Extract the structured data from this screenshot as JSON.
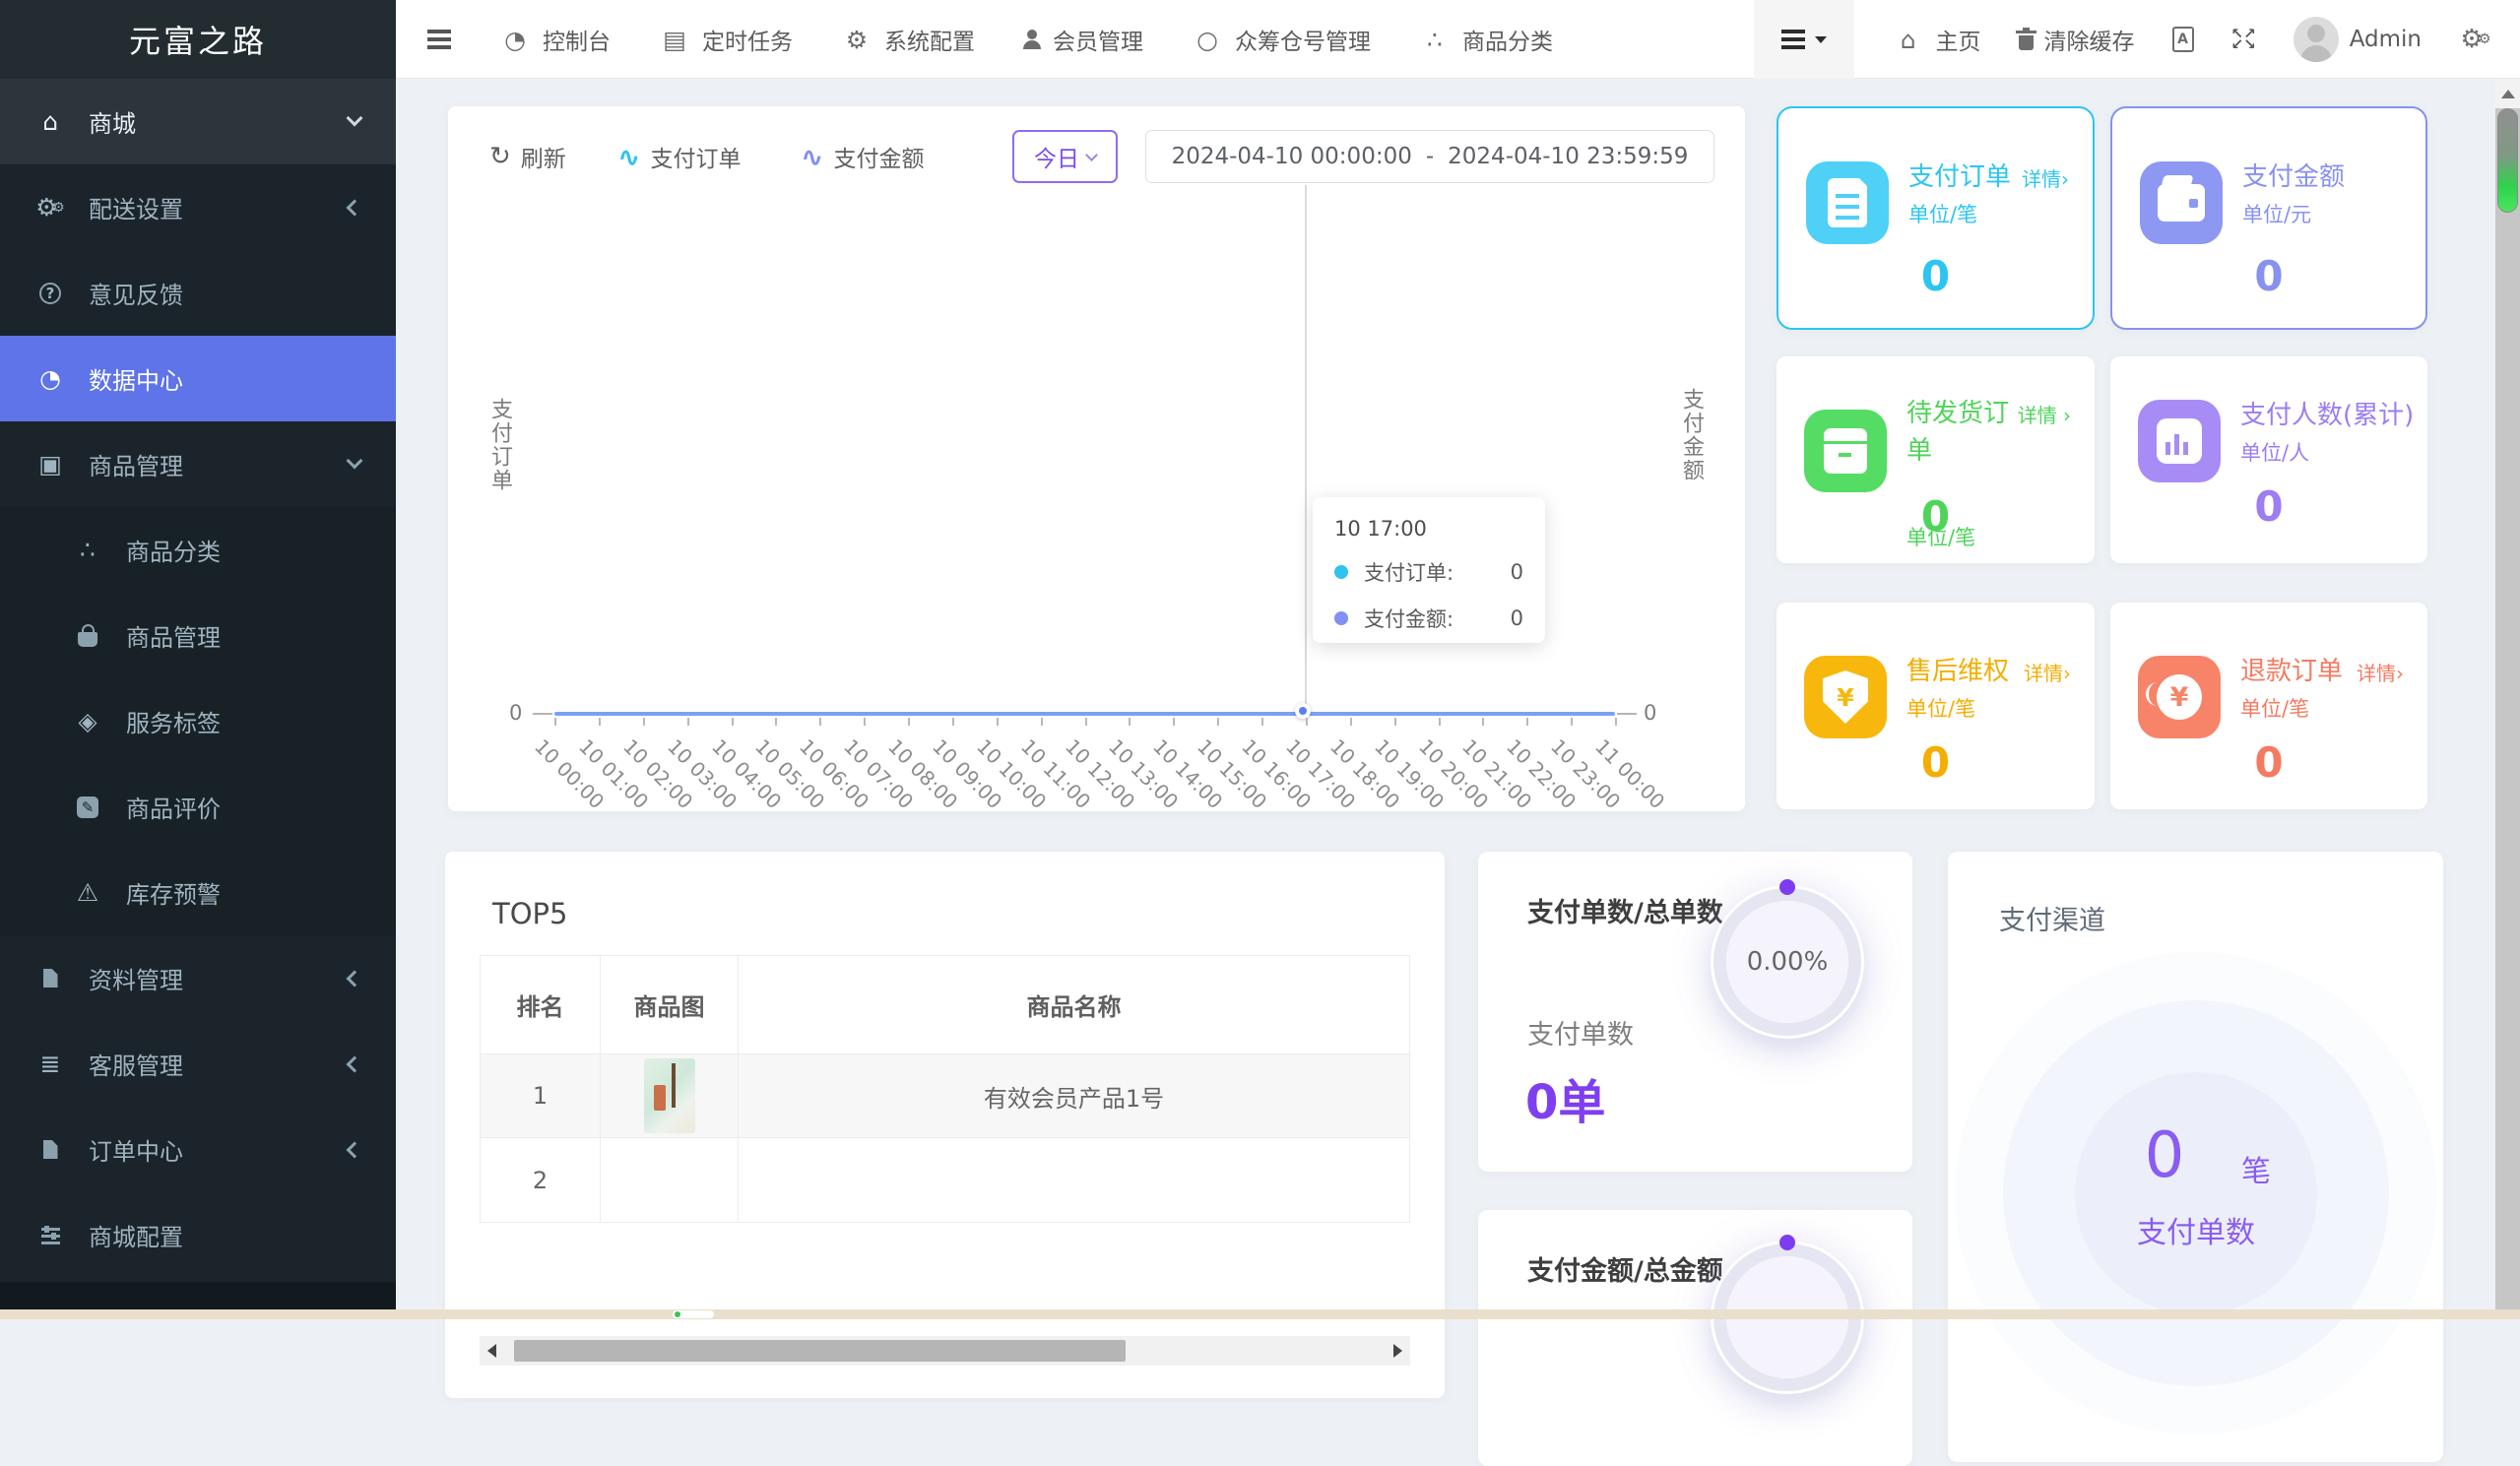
{
  "brand": "元富之路",
  "sidebar": {
    "items": [
      {
        "icon": "home-icon",
        "label": "商城"
      },
      {
        "icon": "cogs-icon",
        "label": "配送设置"
      },
      {
        "icon": "question-circle-icon",
        "label": "意见反馈"
      },
      {
        "icon": "gauge-icon",
        "label": "数据中心"
      },
      {
        "icon": "box-icon",
        "label": "商品管理"
      },
      {
        "icon": "sitemap-icon",
        "label": "商品分类"
      },
      {
        "icon": "bag-icon",
        "label": "商品管理"
      },
      {
        "icon": "tag-icon",
        "label": "服务标签"
      },
      {
        "icon": "pencil-square-icon",
        "label": "商品评价"
      },
      {
        "icon": "warning-icon",
        "label": "库存预警"
      },
      {
        "icon": "file-icon",
        "label": "资料管理"
      },
      {
        "icon": "list-icon",
        "label": "客服管理"
      },
      {
        "icon": "file-icon",
        "label": "订单中心"
      },
      {
        "icon": "sliders-icon",
        "label": "商城配置"
      }
    ]
  },
  "navbar": {
    "links": [
      {
        "icon": "gauge-icon",
        "label": "控制台"
      },
      {
        "icon": "server-icon",
        "label": "定时任务"
      },
      {
        "icon": "gear-icon",
        "label": "系统配置"
      },
      {
        "icon": "user-icon",
        "label": "会员管理"
      },
      {
        "icon": "circle-icon",
        "label": "众筹仓号管理"
      },
      {
        "icon": "sitemap-icon",
        "label": "商品分类"
      }
    ],
    "home": "主页",
    "clear_cache": "清除缓存",
    "username": "Admin"
  },
  "chart_panel": {
    "refresh": "刷新",
    "preset": "今日",
    "date_start": "2024-04-10 00:00:00",
    "date_sep": "-",
    "date_end": "2024-04-10 23:59:59",
    "y_left": "支付订单",
    "y_right": "支付金额",
    "zero_left": "0",
    "zero_right": "0",
    "tooltip": {
      "title": "10 17:00",
      "r1_name": "支付订单:",
      "r1_val": "0",
      "r2_name": "支付金额:",
      "r2_val": "0"
    }
  },
  "chart_data": {
    "type": "line",
    "x": [
      "10 00:00",
      "10 01:00",
      "10 02:00",
      "10 03:00",
      "10 04:00",
      "10 05:00",
      "10 06:00",
      "10 07:00",
      "10 08:00",
      "10 09:00",
      "10 10:00",
      "10 11:00",
      "10 12:00",
      "10 13:00",
      "10 14:00",
      "10 15:00",
      "10 16:00",
      "10 17:00",
      "10 18:00",
      "10 19:00",
      "10 20:00",
      "10 21:00",
      "10 22:00",
      "10 23:00",
      "11 00:00"
    ],
    "series": [
      {
        "name": "支付订单",
        "color": "#2fc3ee",
        "values": [
          0,
          0,
          0,
          0,
          0,
          0,
          0,
          0,
          0,
          0,
          0,
          0,
          0,
          0,
          0,
          0,
          0,
          0,
          0,
          0,
          0,
          0,
          0,
          0,
          0
        ]
      },
      {
        "name": "支付金额",
        "color": "#8190f2",
        "values": [
          0,
          0,
          0,
          0,
          0,
          0,
          0,
          0,
          0,
          0,
          0,
          0,
          0,
          0,
          0,
          0,
          0,
          0,
          0,
          0,
          0,
          0,
          0,
          0,
          0
        ]
      }
    ],
    "ylim_left": [
      0,
      1
    ],
    "ylim_right": [
      0,
      1
    ],
    "highlight_x": "10 17:00",
    "grid": false,
    "legend_position": "top-left"
  },
  "stats": {
    "cards": [
      {
        "title": "支付订单",
        "detail": "详情",
        "arrow": "›",
        "unit": "单位/笔",
        "value": "0",
        "color": "#2cc5f1",
        "tile": "#4ed0f7",
        "icon": "document-icon"
      },
      {
        "title": "支付金额",
        "detail": "",
        "arrow": "",
        "unit": "单位/元",
        "value": "0",
        "color": "#8791f0",
        "tile": "#8d98f2",
        "icon": "wallet-icon"
      },
      {
        "title": "待发货订单",
        "detail": "详情",
        "arrow": "›",
        "unit": "单位/笔",
        "value": "0",
        "color": "#4ed45a",
        "tile": "#55dc64",
        "icon": "package-icon"
      },
      {
        "title": "支付人数(累计)",
        "detail": "",
        "arrow": "",
        "unit": "单位/人",
        "value": "0",
        "color": "#9c7df2",
        "tile": "#a88cf5",
        "icon": "bar-chart-icon"
      },
      {
        "title": "售后维权",
        "detail": "详情",
        "arrow": "›",
        "unit": "单位/笔",
        "value": "0",
        "color": "#f5ad00",
        "tile": "#f7b70d",
        "icon": "shield-yen-icon"
      },
      {
        "title": "退款订单",
        "detail": "详情",
        "arrow": "›",
        "unit": "单位/笔",
        "value": "0",
        "color": "#f57a62",
        "tile": "#f78468",
        "icon": "refund-yen-icon"
      }
    ]
  },
  "top5": {
    "title": "TOP5",
    "h_rank": "排名",
    "h_img": "商品图",
    "h_name": "商品名称",
    "r1_rank": "1",
    "r1_name": "有效会员产品1号",
    "r2_rank": "2",
    "r2_name": ""
  },
  "pay_count": {
    "title": "支付单数/总单数",
    "percent": "0.00%",
    "label": "支付单数",
    "value": "0单"
  },
  "pay_amount": {
    "title": "支付金额/总金额"
  },
  "channel": {
    "title": "支付渠道",
    "value": "0",
    "unit": "笔",
    "label": "支付单数"
  }
}
